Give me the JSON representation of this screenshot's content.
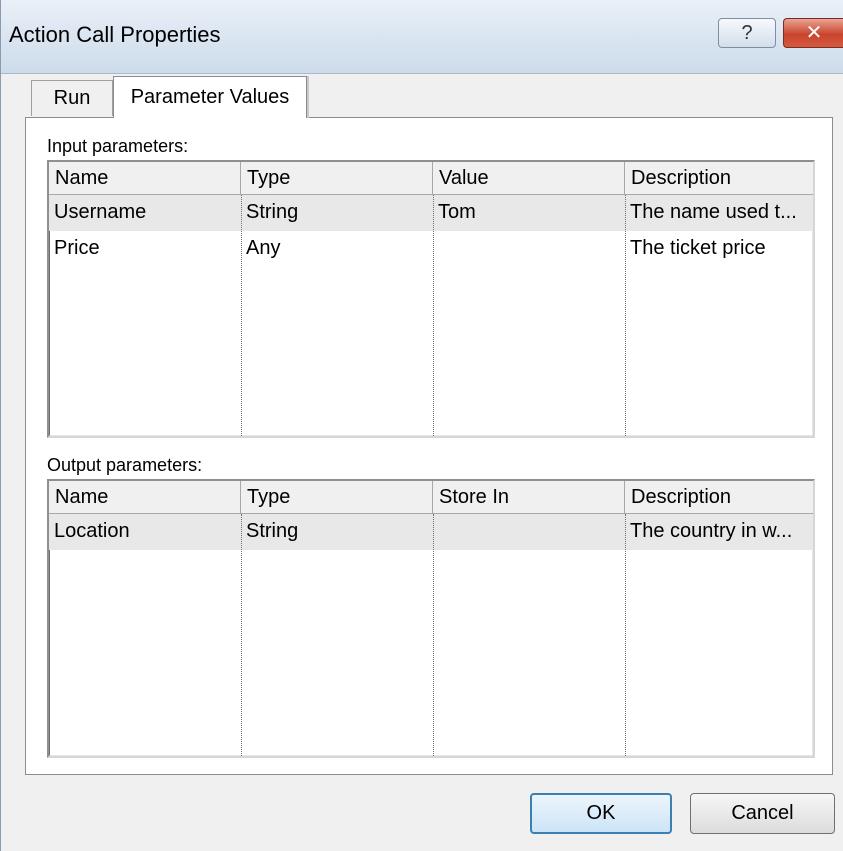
{
  "window": {
    "title": "Action Call Properties",
    "help_label": "?",
    "close_label": "✕"
  },
  "tabs": [
    {
      "label": "Run",
      "active": false
    },
    {
      "label": "Parameter Values",
      "active": true
    }
  ],
  "input_parameters": {
    "label": "Input parameters:",
    "columns": [
      "Name",
      "Type",
      "Value",
      "Description"
    ],
    "rows": [
      {
        "name": "Username",
        "type": "String",
        "value": "Tom",
        "description": "The name used t...",
        "selected": true
      },
      {
        "name": "Price",
        "type": "Any",
        "value": "",
        "description": "The ticket price",
        "selected": false
      }
    ]
  },
  "output_parameters": {
    "label": "Output parameters:",
    "columns": [
      "Name",
      "Type",
      "Store In",
      "Description"
    ],
    "rows": [
      {
        "name": "Location",
        "type": "String",
        "store_in": "",
        "description": "The country in w...",
        "selected": true
      }
    ]
  },
  "buttons": {
    "ok": "OK",
    "cancel": "Cancel"
  },
  "colors": {
    "titlebar": "#cddbea",
    "close_button": "#c9442c",
    "selected_row": "#e8e8e8",
    "default_button_border": "#3c7fb1"
  }
}
